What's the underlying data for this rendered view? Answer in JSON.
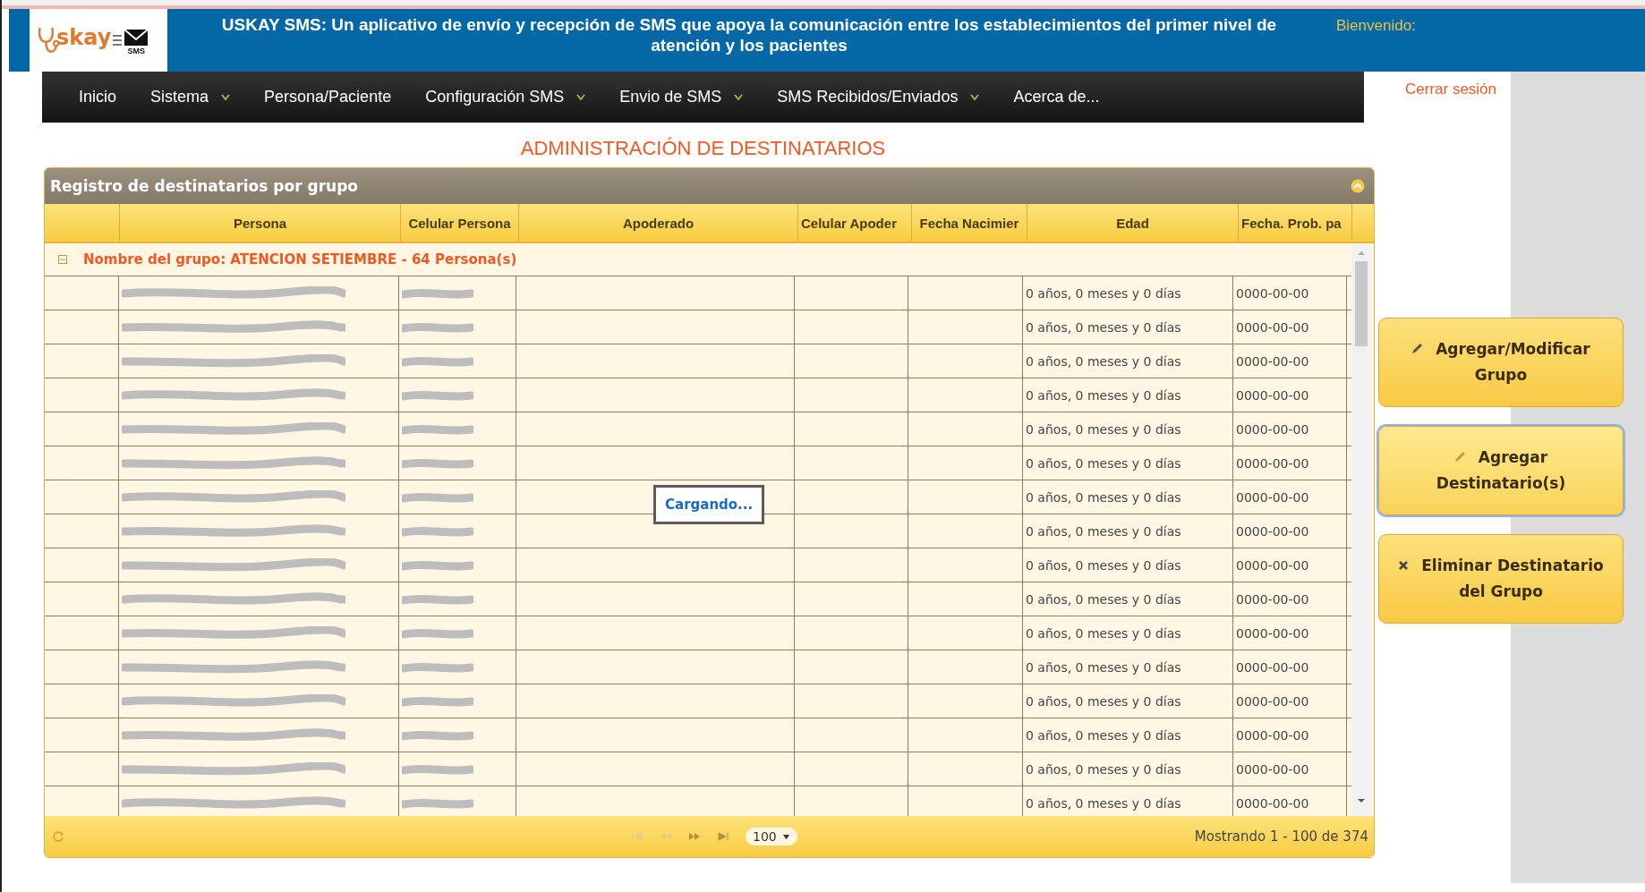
{
  "header": {
    "logo_word": "skay",
    "logo_badge": "SMS",
    "title": "USKAY SMS: Un aplicativo de envío y recepción de SMS que apoya la comunicación entre los establecimientos del primer nivel de atención y los pacientes",
    "welcome": "Bienvenido:",
    "logout": "Cerrar sesión"
  },
  "nav": [
    {
      "label": "Inicio",
      "dropdown": false
    },
    {
      "label": "Sistema",
      "dropdown": true
    },
    {
      "label": "Persona/Paciente",
      "dropdown": false
    },
    {
      "label": "Configuración SMS",
      "dropdown": true
    },
    {
      "label": "Envio de SMS",
      "dropdown": true
    },
    {
      "label": "SMS Recibidos/Enviados",
      "dropdown": true
    },
    {
      "label": "Acerca de...",
      "dropdown": false
    }
  ],
  "page_title": "ADMINISTRACIÓN DE DESTINATARIOS",
  "panel": {
    "title": "Registro de destinatarios por grupo",
    "columns": [
      "Persona",
      "Celular Persona",
      "Apoderado",
      "Celular Apoder",
      "Fecha Nacimier",
      "Edad",
      "Fecha. Prob. pa"
    ],
    "group": {
      "expanded": true,
      "label": "Nombre del grupo: ATENCION SETIEMBRE - 64 Persona(s)"
    },
    "rows": [
      {
        "edad": "0 años, 0 meses y 0 días",
        "fecha_prob": "0000-00-00"
      },
      {
        "edad": "0 años, 0 meses y 0 días",
        "fecha_prob": "0000-00-00"
      },
      {
        "edad": "0 años, 0 meses y 0 días",
        "fecha_prob": "0000-00-00"
      },
      {
        "edad": "0 años, 0 meses y 0 días",
        "fecha_prob": "0000-00-00"
      },
      {
        "edad": "0 años, 0 meses y 0 días",
        "fecha_prob": "0000-00-00"
      },
      {
        "edad": "0 años, 0 meses y 0 días",
        "fecha_prob": "0000-00-00"
      },
      {
        "edad": "0 años, 0 meses y 0 días",
        "fecha_prob": "0000-00-00"
      },
      {
        "edad": "0 años, 0 meses y 0 días",
        "fecha_prob": "0000-00-00"
      },
      {
        "edad": "0 años, 0 meses y 0 días",
        "fecha_prob": "0000-00-00"
      },
      {
        "edad": "0 años, 0 meses y 0 días",
        "fecha_prob": "0000-00-00"
      },
      {
        "edad": "0 años, 0 meses y 0 días",
        "fecha_prob": "0000-00-00"
      },
      {
        "edad": "0 años, 0 meses y 0 días",
        "fecha_prob": "0000-00-00"
      },
      {
        "edad": "0 años, 0 meses y 0 días",
        "fecha_prob": "0000-00-00"
      },
      {
        "edad": "0 años, 0 meses y 0 días",
        "fecha_prob": "0000-00-00"
      },
      {
        "edad": "0 años, 0 meses y 0 días",
        "fecha_prob": "0000-00-00"
      },
      {
        "edad": "0 años, 0 meses y 0 días",
        "fecha_prob": "0000-00-00"
      }
    ],
    "loading": "Cargando...",
    "pager": {
      "page_size": "100",
      "summary": "Mostrando 1 - 100 de 374"
    }
  },
  "actions": [
    {
      "label": "Agregar/Modificar Grupo",
      "kind": "edit",
      "focused": false
    },
    {
      "label": "Agregar Destinatario(s)",
      "kind": "edit",
      "focused": true
    },
    {
      "label": "Eliminar Destinatario del Grupo",
      "kind": "delete",
      "focused": false
    }
  ]
}
